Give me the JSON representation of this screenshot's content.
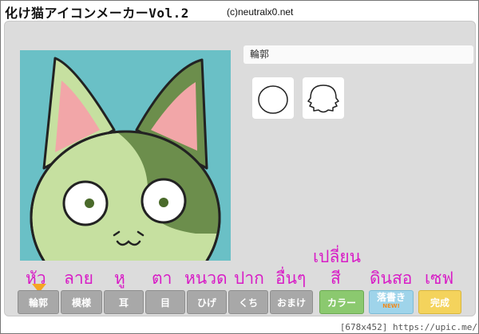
{
  "app": {
    "title": "化け猫アイコンメーカーVol.2",
    "credit": "(c)neutralx0.net"
  },
  "editor": {
    "section_label": "輪郭"
  },
  "tabs": [
    {
      "label": "輪郭",
      "thai": "หัว"
    },
    {
      "label": "模様",
      "thai": "ลาย"
    },
    {
      "label": "耳",
      "thai": "หู"
    },
    {
      "label": "目",
      "thai": "ตา"
    },
    {
      "label": "ひげ",
      "thai": "หนวด"
    },
    {
      "label": "くち",
      "thai": "ปาก"
    },
    {
      "label": "おまけ",
      "thai": "อื่นๆ"
    },
    {
      "label": "カラー",
      "thai": "สี",
      "thai_top": "เปลี่ยน"
    },
    {
      "label": "落書き",
      "badge": "NEW!",
      "thai": "ดินสอ"
    },
    {
      "label": "完成",
      "thai": "เซฟ"
    }
  ],
  "colors": {
    "canvas_bg": "#6ac0c6",
    "face_light": "#c6e0a0",
    "face_dark": "#6c8e4c",
    "ear_inner": "#f2a6a8",
    "annotation": "#d81cc6",
    "selected_pointer": "#f5a623"
  },
  "icons": [
    "head-round-option-icon",
    "head-fluffy-option-icon",
    "cat-face-preview",
    "selection-pointer-icon"
  ],
  "watermark": "[678x452] https://upic.me/"
}
